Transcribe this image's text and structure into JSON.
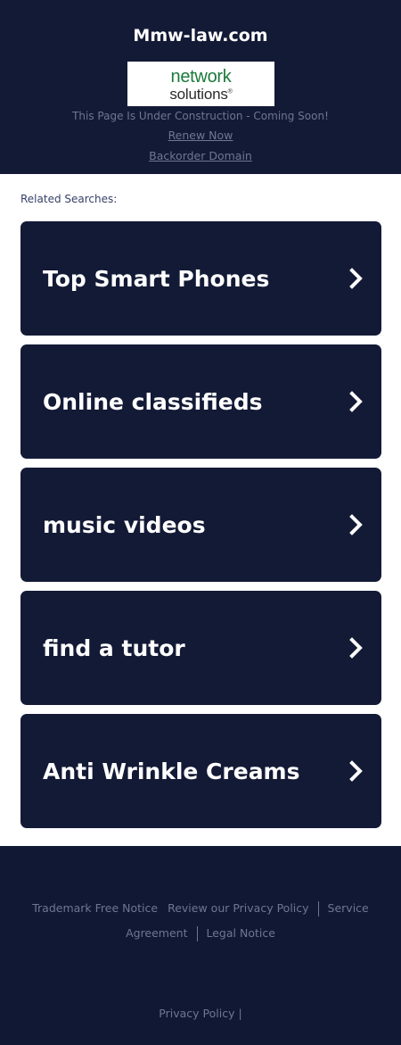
{
  "header": {
    "domain": "Mmw-law.com",
    "logo": {
      "line1": "network",
      "line2": "solutions",
      "mark": "®"
    },
    "construction_text": "This Page Is Under Construction - Coming Soon!",
    "renew_link": "Renew Now",
    "backorder_link": "Backorder Domain"
  },
  "main": {
    "related_label": "Related Searches:",
    "results": [
      {
        "label": "Top Smart Phones"
      },
      {
        "label": "Online classifieds"
      },
      {
        "label": "music videos"
      },
      {
        "label": "find a tutor"
      },
      {
        "label": "Anti Wrinkle Creams"
      }
    ],
    "chevron_icon": "chevron-right-icon"
  },
  "footer": {
    "links": {
      "trademark": "Trademark Free Notice",
      "privacy_review": "Review our Privacy Policy",
      "service": "Service Agreement",
      "legal": "Legal Notice"
    },
    "bottom_privacy": "Privacy Policy",
    "bottom_separator": "|"
  },
  "colors": {
    "dark_navy": "#131a36",
    "footer_navy": "#111834",
    "muted_text": "#6f7690",
    "logo_green": "#1c7a3c"
  }
}
